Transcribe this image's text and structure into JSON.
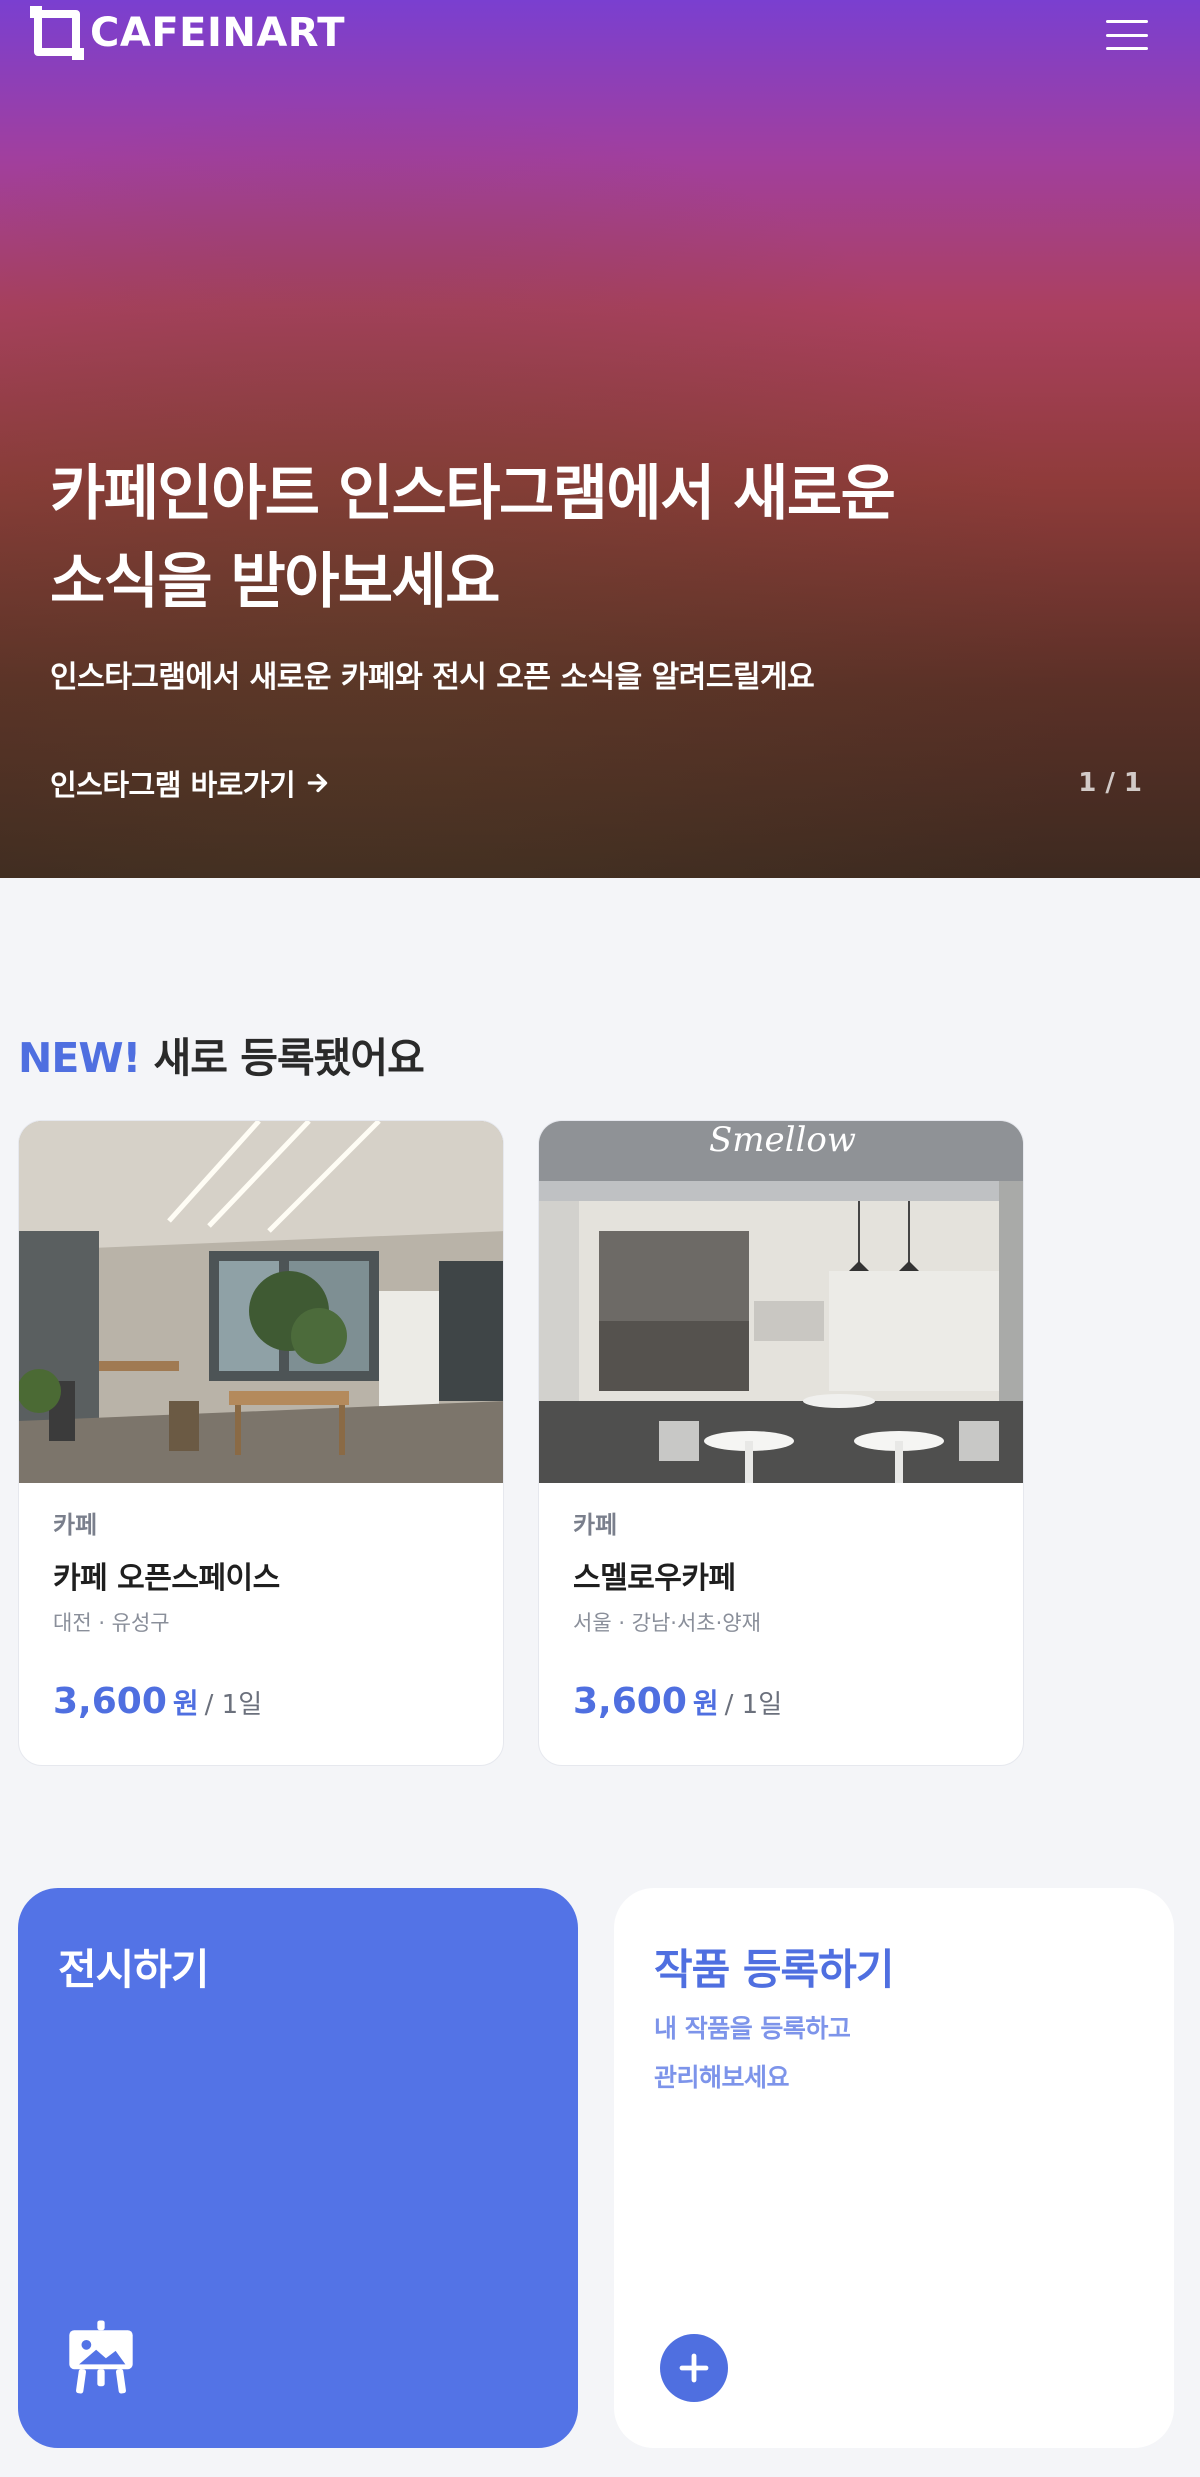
{
  "header": {
    "logo_text": "CAFEINART",
    "menu_icon": "hamburger-menu-icon"
  },
  "hero": {
    "title_line1": "카페인아트 인스타그램에서 새로운",
    "title_line2": "소식을 받아보세요",
    "subtitle": "인스타그램에서 새로운 카페와 전시 오픈 소식을 알려드릴게요",
    "link_label": "인스타그램 바로가기",
    "link_icon": "arrow-right-icon",
    "pagination": "1 / 1"
  },
  "new_section": {
    "accent": "NEW!",
    "title": "새로 등록됐어요"
  },
  "cards": [
    {
      "category": "카페",
      "name": "카페 오픈스페이스",
      "location": "대전 · 유성구",
      "price": "3,600",
      "price_unit": "원",
      "price_period": "/ 1일"
    },
    {
      "category": "카페",
      "name": "스멜로우카페",
      "location": "서울 · 강남·서초·양재",
      "price": "3,600",
      "price_unit": "원",
      "price_period": "/ 1일",
      "sign_text": "Smellow"
    }
  ],
  "tiles": {
    "exhibit": {
      "title": "전시하기",
      "icon": "easel-icon"
    },
    "register": {
      "title": "작품 등록하기",
      "desc_line1": "내 작품을 등록하고",
      "desc_line2": "관리해보세요",
      "icon": "plus-circle-icon"
    }
  },
  "colors": {
    "accent": "#4f6fe0",
    "tile_blue": "#5373e6",
    "background": "#f4f5f8"
  }
}
